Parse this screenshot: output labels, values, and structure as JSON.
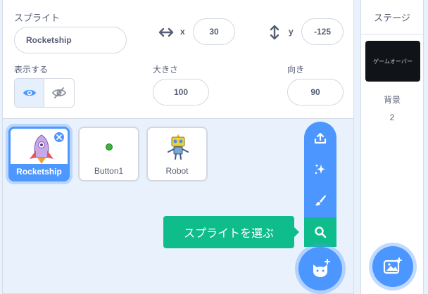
{
  "sprite_info": {
    "sprite_label": "スプライト",
    "sprite_name": "Rocketship",
    "x_label": "x",
    "x_value": "30",
    "y_label": "y",
    "y_value": "-125",
    "show_label": "表示する",
    "size_label": "大きさ",
    "size_value": "100",
    "direction_label": "向き",
    "direction_value": "90",
    "show_state": "visible"
  },
  "sprites": [
    {
      "name": "Rocketship",
      "selected": true
    },
    {
      "name": "Button1",
      "selected": false
    },
    {
      "name": "Robot",
      "selected": false
    }
  ],
  "flyout": {
    "items": [
      "upload-icon",
      "surprise-icon",
      "paint-icon",
      "search-icon"
    ],
    "tooltip": "スプライトを選ぶ"
  },
  "stage": {
    "title": "ステージ",
    "backdrop_thumb_text": "ゲームオーバー",
    "backdrop_label": "背景",
    "backdrop_count": "2"
  },
  "colors": {
    "accent": "#4c97ff",
    "green": "#0fbd8c",
    "text": "#575e75",
    "bg": "#e9f1fc"
  }
}
